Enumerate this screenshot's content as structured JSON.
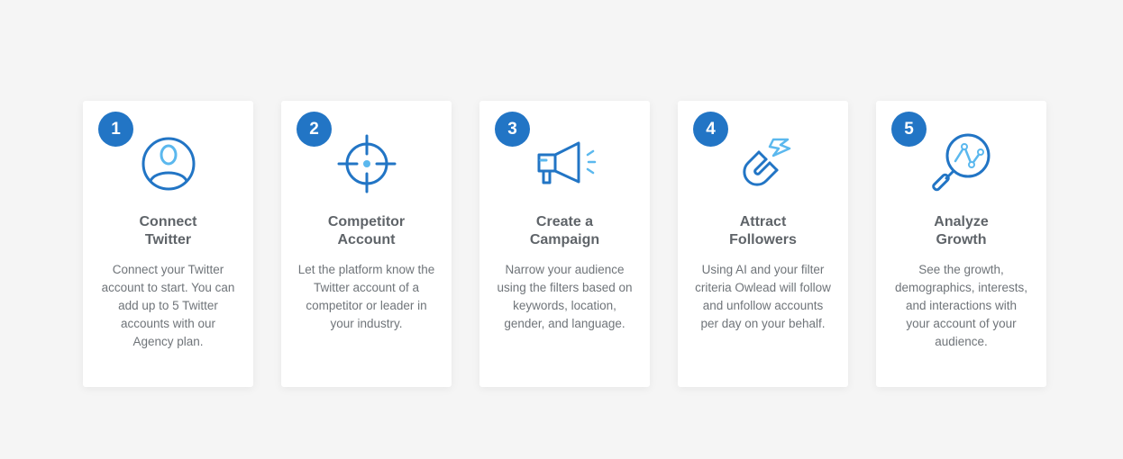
{
  "colors": {
    "accent": "#2275c5",
    "accent_light": "#5bb8ee",
    "title": "#5f6469",
    "text": "#6f7479"
  },
  "steps": [
    {
      "number": "1",
      "icon": "user-profile-icon",
      "title_line1": "Connect",
      "title_line2": "Twitter",
      "description": "Connect your Twitter account to start. You can add up to 5 Twitter accounts with our Agency plan."
    },
    {
      "number": "2",
      "icon": "crosshair-target-icon",
      "title_line1": "Competitor",
      "title_line2": "Account",
      "description": "Let the platform know the Twitter account of a competitor or leader in your industry."
    },
    {
      "number": "3",
      "icon": "megaphone-icon",
      "title_line1": "Create a",
      "title_line2": "Campaign",
      "description": "Narrow your audience using the filters based on keywords, location, gender, and language."
    },
    {
      "number": "4",
      "icon": "magnet-icon",
      "title_line1": "Attract",
      "title_line2": "Followers",
      "description": "Using AI and your filter criteria Owlead will follow and unfollow accounts per day on your behalf."
    },
    {
      "number": "5",
      "icon": "analytics-magnifier-icon",
      "title_line1": "Analyze",
      "title_line2": "Growth",
      "description": "See the growth, demographics, interests, and interactions with your account of your audience."
    }
  ]
}
